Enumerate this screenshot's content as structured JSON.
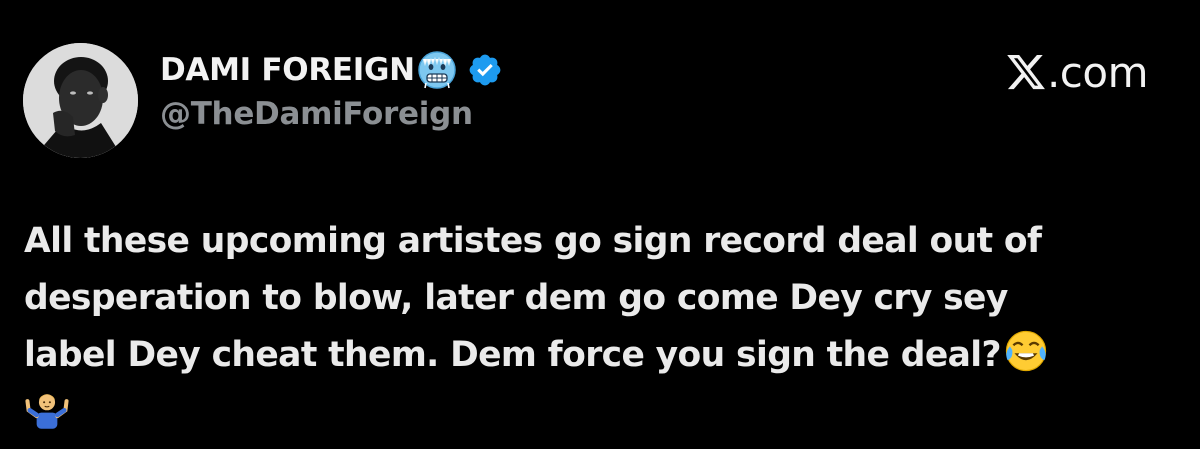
{
  "author": {
    "display_name": "DAMI FOREIGN",
    "name_emoji": "cold-face-emoji",
    "verified": true,
    "verified_color": "#1d9bf0",
    "handle": "@TheDamiForeign"
  },
  "brand": {
    "logo": "x-logo-icon",
    "text": ".com"
  },
  "tweet": {
    "lines": [
      "All these upcoming artistes go sign record deal out of",
      "desperation to blow, later dem go come Dey cry sey",
      "label Dey cheat them. Dem force you sign the deal?"
    ],
    "emojis": [
      "face-with-tears-of-joy-emoji",
      "person-shrugging-emoji"
    ]
  },
  "colors": {
    "background": "#000000",
    "text_primary": "#e7e9ea",
    "text_secondary": "#8b8f93",
    "verified_blue": "#1d9bf0"
  }
}
